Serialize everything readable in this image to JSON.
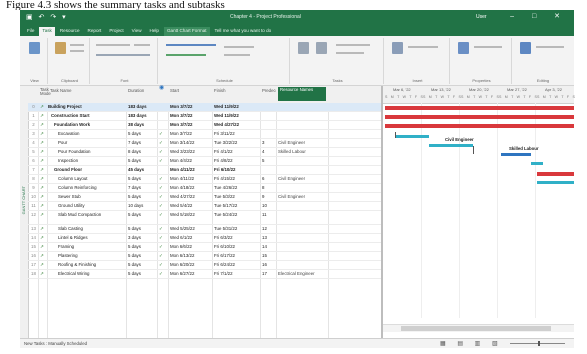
{
  "caption": "Figure 4.3 shows the summary tasks and subtasks",
  "window": {
    "title": "Chapter 4 - Project Professional",
    "user": "User",
    "quick_access": "▣ ↶ ↷ ▾",
    "window_controls": "– □ ✕"
  },
  "tabs": [
    "File",
    "Task",
    "Resource",
    "Report",
    "Project",
    "View",
    "Help",
    "Gantt Chart Format",
    "Tell me what you want to do"
  ],
  "ribbon": {
    "groups": [
      "View",
      "Clipboard",
      "Font",
      "Schedule",
      "Tasks",
      "Insert",
      "Properties",
      "Editing"
    ]
  },
  "sidebar": {
    "label": "GANTT CHART"
  },
  "grid": {
    "headers": {
      "mode": "Task Mode",
      "name": "Task Name",
      "duration": "Duration",
      "start": "Start",
      "finish": "Finish",
      "predecessors": "Predecessors",
      "resource": "Resource Names"
    },
    "rows": [
      {
        "id": "0",
        "name": "Building Project",
        "duration": "183 days",
        "done": "",
        "start": "Mon 3/7/22",
        "finish": "Wed 11/9/22",
        "pred": "",
        "res": ""
      },
      {
        "id": "1",
        "name": "Construction Start",
        "duration": "183 days",
        "done": "",
        "start": "Mon 3/7/22",
        "finish": "Wed 11/9/22",
        "pred": "",
        "res": ""
      },
      {
        "id": "2",
        "name": "Foundation Work",
        "duration": "38 days",
        "done": "",
        "start": "Mon 3/7/22",
        "finish": "Wed 4/27/22",
        "pred": "",
        "res": ""
      },
      {
        "id": "3",
        "name": "Excavation",
        "duration": "5 days",
        "done": "✓",
        "start": "Mon 3/7/22",
        "finish": "Fri 3/11/22",
        "pred": "",
        "res": ""
      },
      {
        "id": "4",
        "name": "Pour",
        "duration": "7 days",
        "done": "✓",
        "start": "Mon 3/14/22",
        "finish": "Tue 3/22/22",
        "pred": "3",
        "res": "Civil Engineer"
      },
      {
        "id": "5",
        "name": "Pour Foundation",
        "duration": "8 days",
        "done": "✓",
        "start": "Wed 3/23/22",
        "finish": "Fri 4/1/22",
        "pred": "4",
        "res": "Skilled Labour"
      },
      {
        "id": "6",
        "name": "Inspection",
        "duration": "5 days",
        "done": "✓",
        "start": "Mon 4/4/22",
        "finish": "Fri 4/8/22",
        "pred": "5",
        "res": ""
      },
      {
        "id": "7",
        "name": "Ground Floor",
        "duration": "45 days",
        "done": "",
        "start": "Mon 4/11/22",
        "finish": "Fri 6/10/22",
        "pred": "",
        "res": ""
      },
      {
        "id": "8",
        "name": "Column Layout",
        "duration": "5 days",
        "done": "✓",
        "start": "Mon 4/11/22",
        "finish": "Fri 4/15/22",
        "pred": "6",
        "res": "Civil Engineer"
      },
      {
        "id": "9",
        "name": "Column Reinforcing",
        "duration": "7 days",
        "done": "✓",
        "start": "Mon 4/18/22",
        "finish": "Tue 4/26/22",
        "pred": "8",
        "res": ""
      },
      {
        "id": "10",
        "name": "Sewer Stub",
        "duration": "5 days",
        "done": "✓",
        "start": "Wed 4/27/22",
        "finish": "Tue 5/3/22",
        "pred": "9",
        "res": "Civil Engineer"
      },
      {
        "id": "11",
        "name": "Ground Utility",
        "duration": "10 days",
        "done": "✓",
        "start": "Wed 5/4/22",
        "finish": "Tue 5/17/22",
        "pred": "10",
        "res": ""
      },
      {
        "id": "12",
        "name": "Slab Mud Compaction",
        "duration": "5 days",
        "done": "✓",
        "start": "Wed 5/18/22",
        "finish": "Tue 5/24/22",
        "pred": "11",
        "res": ""
      },
      {
        "id": "13",
        "name": "Slab Casting",
        "duration": "5 days",
        "done": "✓",
        "start": "Wed 5/25/22",
        "finish": "Tue 5/31/22",
        "pred": "12",
        "res": ""
      },
      {
        "id": "14",
        "name": "Lintel & Ridges",
        "duration": "3 days",
        "done": "✓",
        "start": "Wed 6/1/22",
        "finish": "Fri 6/3/22",
        "pred": "13",
        "res": ""
      },
      {
        "id": "15",
        "name": "Framing",
        "duration": "5 days",
        "done": "✓",
        "start": "Mon 6/6/22",
        "finish": "Fri 6/10/22",
        "pred": "14",
        "res": ""
      },
      {
        "id": "16",
        "name": "Plastering",
        "duration": "5 days",
        "done": "✓",
        "start": "Mon 6/13/22",
        "finish": "Fri 6/17/22",
        "pred": "15",
        "res": ""
      },
      {
        "id": "17",
        "name": "Roofing & Finishing",
        "duration": "5 days",
        "done": "✓",
        "start": "Mon 6/20/22",
        "finish": "Fri 6/24/22",
        "pred": "16",
        "res": ""
      },
      {
        "id": "18",
        "name": "Electrical Wiring",
        "duration": "5 days",
        "done": "✓",
        "start": "Mon 6/27/22",
        "finish": "Fri 7/1/22",
        "pred": "17",
        "res": "Electrical Engineer"
      }
    ]
  },
  "gantt": {
    "weeks": [
      "Mar 6, '22",
      "Mar 13, '22",
      "Mar 20, '22",
      "Mar 27, '22",
      "Apr 3, '22"
    ],
    "days": "S M T W T F S",
    "bar_labels": [
      "Civil Engineer",
      "Skilled Labour"
    ]
  },
  "status": {
    "text": "New Tasks : Manually Scheduled",
    "views": "▦ ▤ ▥ ▧"
  },
  "colors": {
    "accent": "#217346",
    "summary_bar": "#d9383c",
    "task_bar": "#30b0c7",
    "task_bar_alt": "#2e75c0"
  }
}
